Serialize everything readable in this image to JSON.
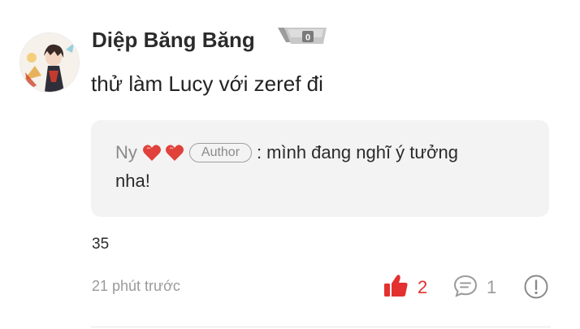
{
  "comment": {
    "avatar_icon": "anime-character-avatar",
    "username": "Diệp Băng Băng",
    "level_badge_text": "0",
    "text": "thử làm Lucy với zeref đi"
  },
  "reply": {
    "name": "Ny",
    "hearts_icon": "red-heart-icon",
    "author_tag": "Author",
    "colon": ":",
    "text_line1": "mình đang nghĩ ý tưởng",
    "text_line2": "nha!"
  },
  "stats": {
    "count_value": "35",
    "time_ago": "21 phút trước",
    "likes": "2",
    "comments": "1"
  },
  "colors": {
    "like_red": "#e2312f",
    "heart_red": "#e0413a",
    "reply_bg": "#f3f3f3"
  }
}
